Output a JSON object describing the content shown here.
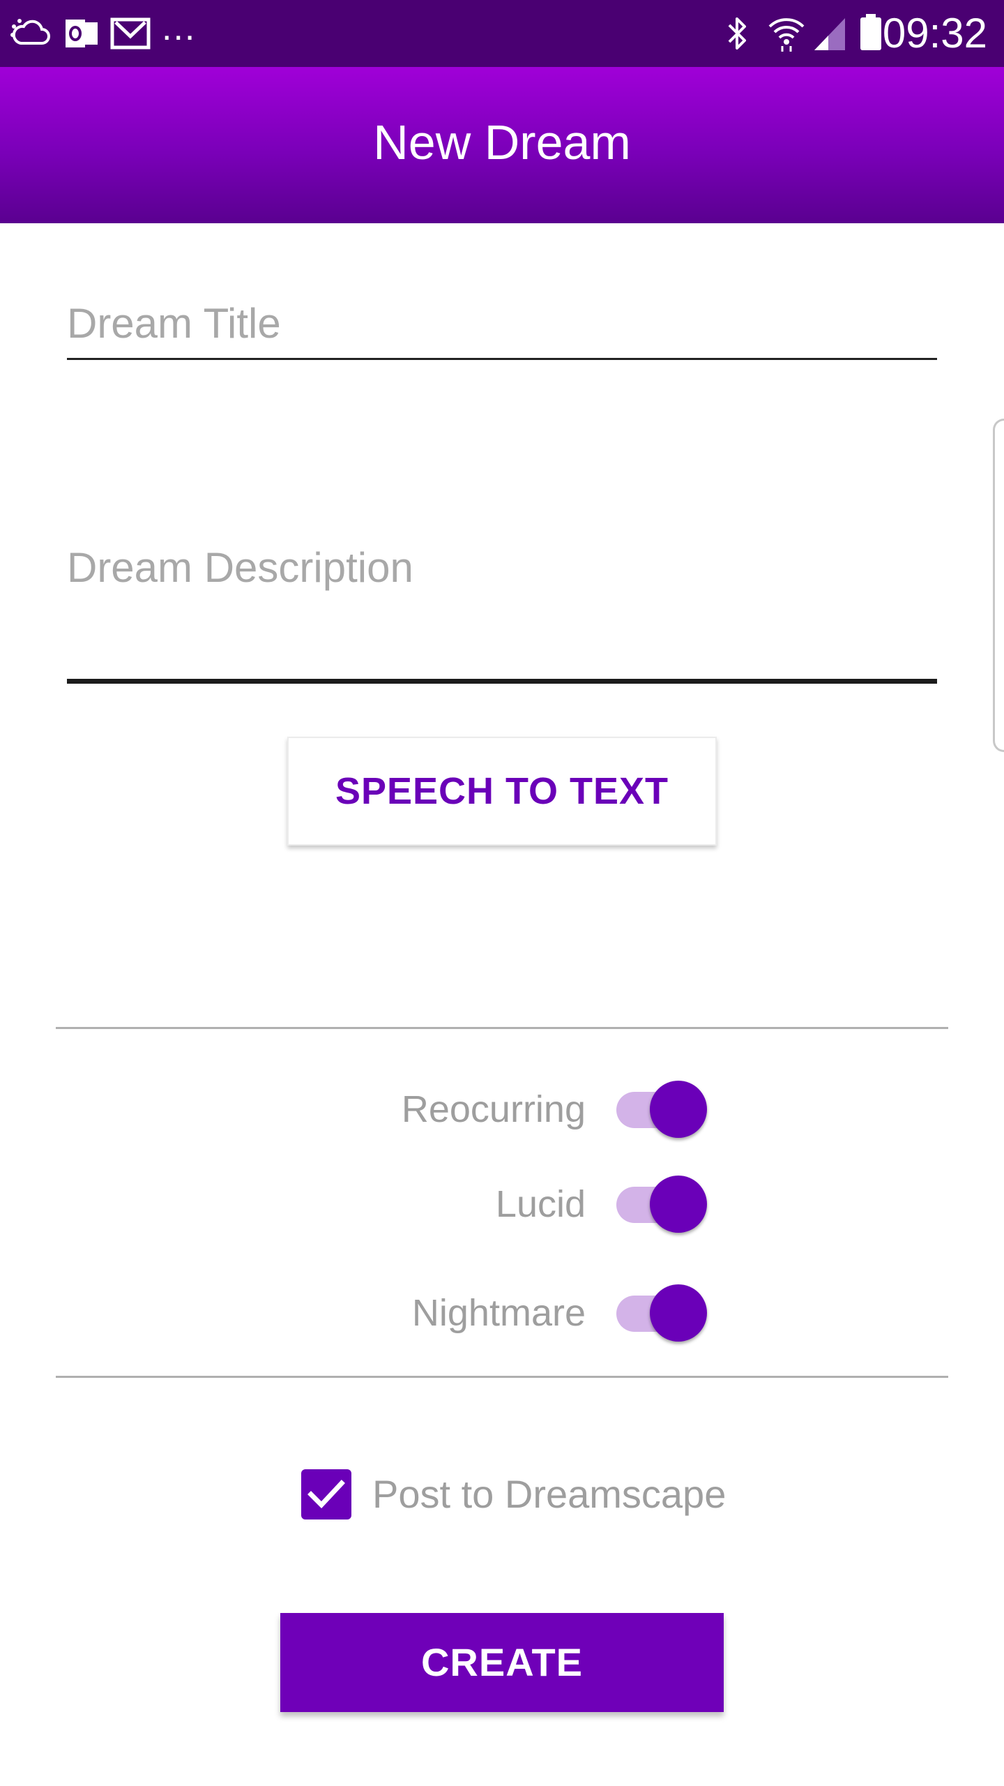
{
  "status_bar": {
    "time": "09:32",
    "more": "...",
    "icons": [
      "cloud-sync-icon",
      "outlook-icon",
      "gmail-icon",
      "bluetooth-icon",
      "wifi-icon",
      "signal-icon",
      "battery-icon"
    ]
  },
  "app_bar": {
    "title": "New Dream"
  },
  "form": {
    "title_placeholder": "Dream Title",
    "description_placeholder": "Dream Description",
    "speech_button": "SPEECH TO TEXT"
  },
  "toggles": [
    {
      "label": "Reocurring",
      "on": true
    },
    {
      "label": "Lucid",
      "on": true
    },
    {
      "label": "Nightmare",
      "on": true
    }
  ],
  "post": {
    "label": "Post to Dreamscape",
    "checked": true
  },
  "create_button": "CREATE",
  "colors": {
    "status_bar": "#4a0072",
    "app_bar_top": "#a000d8",
    "app_bar_bottom": "#5a0090",
    "accent": "#6a00b8",
    "switch_track": "#d3b3e8",
    "label_gray": "#9e9e9e"
  }
}
